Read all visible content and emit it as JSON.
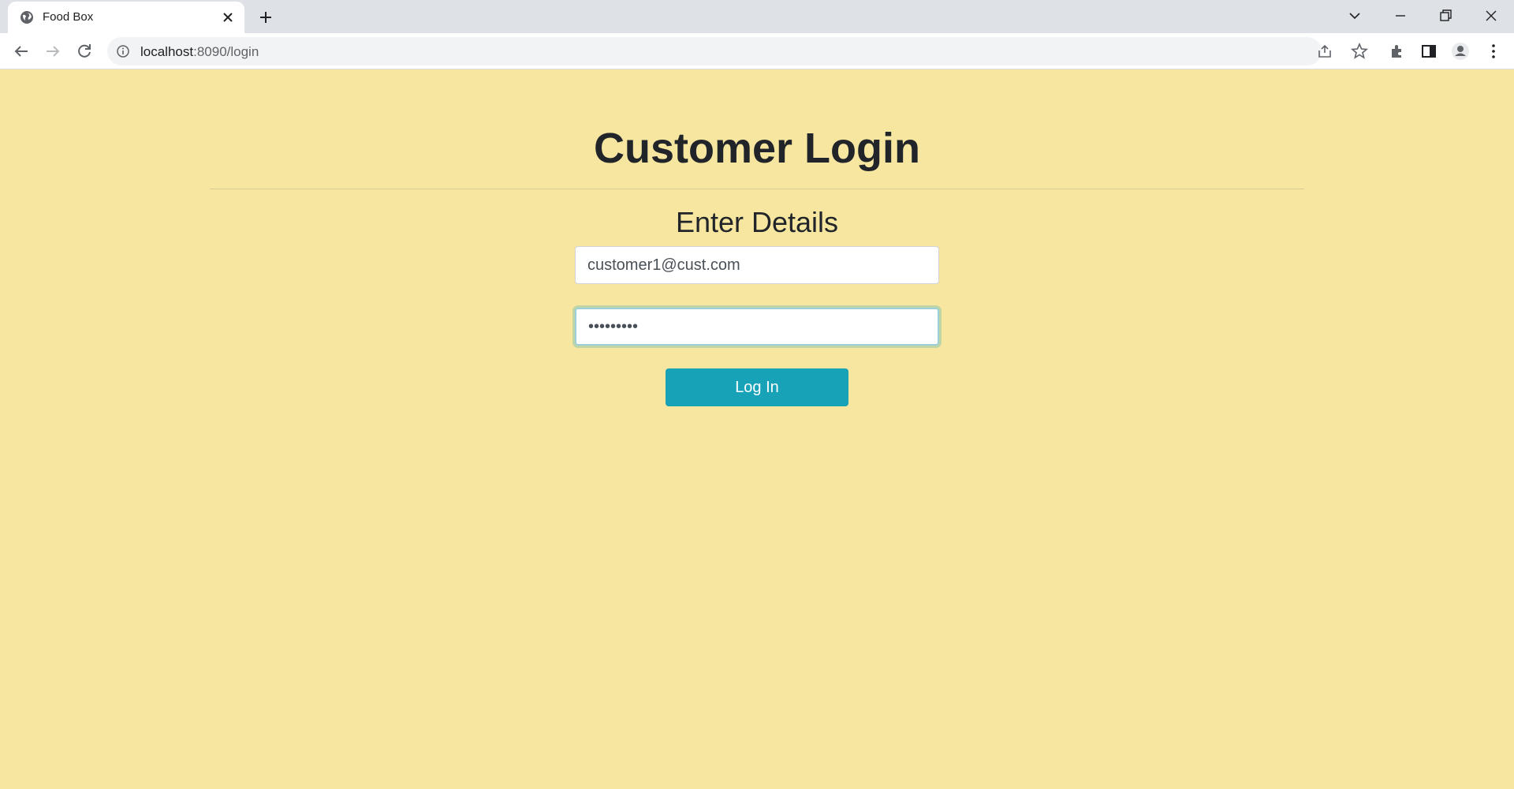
{
  "browser": {
    "tab_title": "Food Box",
    "url_host": "localhost",
    "url_path": ":8090/login"
  },
  "page": {
    "title": "Customer Login",
    "subtitle": "Enter Details",
    "email_value": "customer1@cust.com",
    "password_value": "•••••••••",
    "login_label": "Log In"
  },
  "colors": {
    "page_background": "#f7e6a0",
    "button": "#17a2b8",
    "text": "#212529"
  },
  "icons": [
    "globe-icon",
    "close-icon",
    "plus-icon",
    "chevron-down-icon",
    "minimize-icon",
    "restore-icon",
    "back-icon",
    "forward-icon",
    "reload-icon",
    "info-icon",
    "share-icon",
    "star-icon",
    "extensions-icon",
    "side-panel-icon",
    "profile-icon",
    "menu-icon"
  ]
}
